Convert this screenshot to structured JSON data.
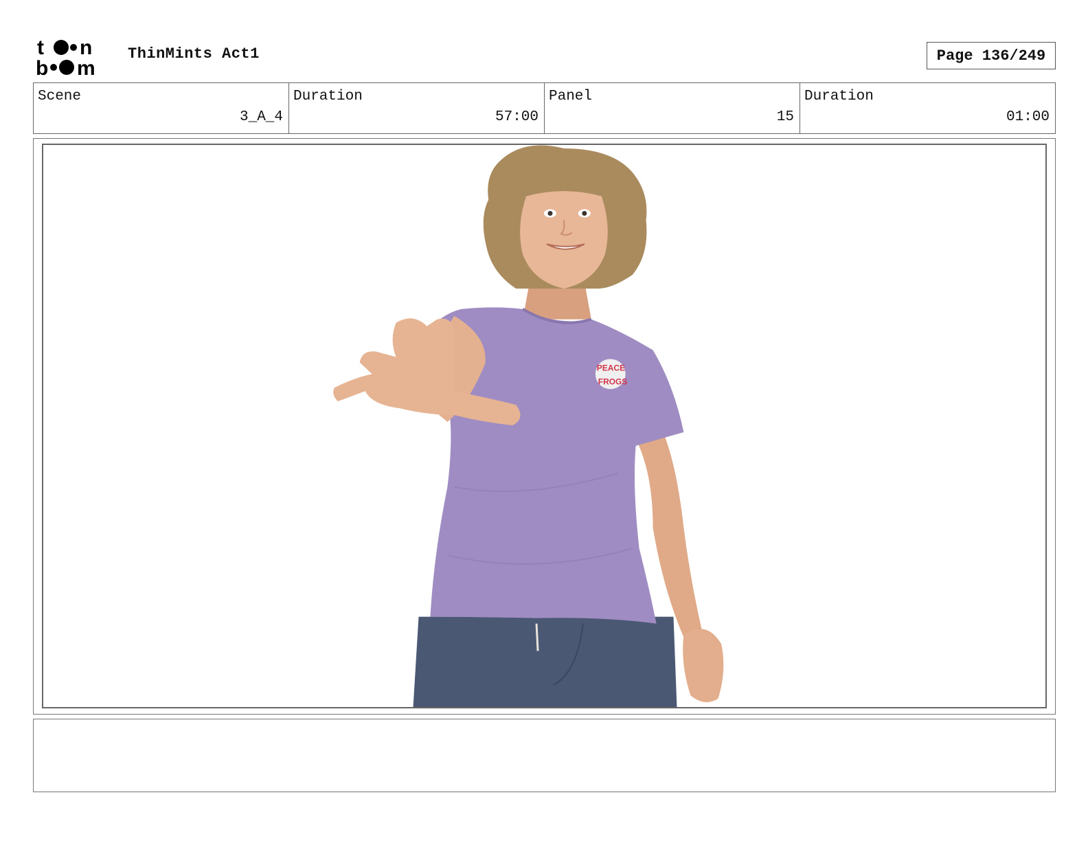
{
  "header": {
    "logo_text": "toon boom",
    "project_title": "ThinMints Act1",
    "page_label": "Page 136/249"
  },
  "info": {
    "scene_label": "Scene",
    "scene_value": "3_A_4",
    "scene_duration_label": "Duration",
    "scene_duration_value": "57:00",
    "panel_label": "Panel",
    "panel_value": "15",
    "panel_duration_label": "Duration",
    "panel_duration_value": "01:00"
  },
  "panel": {
    "shirt_logo_text": "FROGS",
    "colors": {
      "shirt": "#9f8cc2",
      "skin": "#e7b493",
      "hair": "#a98b5e",
      "jeans": "#4a5873"
    }
  },
  "notes": {
    "text": ""
  }
}
